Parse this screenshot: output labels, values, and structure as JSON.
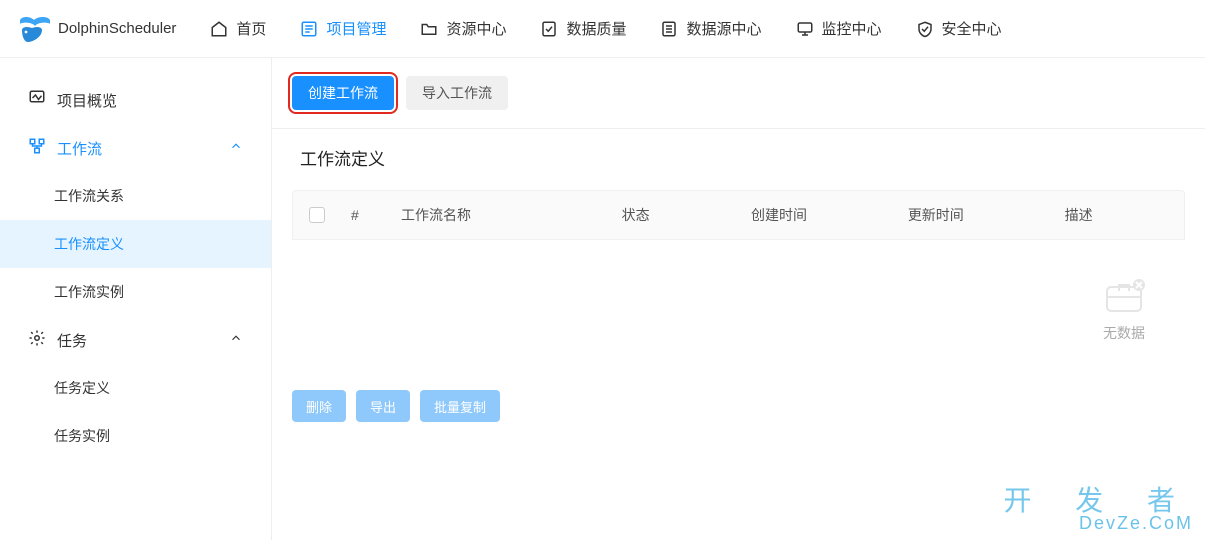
{
  "brand": {
    "name": "DolphinScheduler"
  },
  "topnav": [
    {
      "key": "home",
      "label": "首页"
    },
    {
      "key": "project",
      "label": "项目管理"
    },
    {
      "key": "resource",
      "label": "资源中心"
    },
    {
      "key": "dataquality",
      "label": "数据质量"
    },
    {
      "key": "datasource",
      "label": "数据源中心"
    },
    {
      "key": "monitor",
      "label": "监控中心"
    },
    {
      "key": "security",
      "label": "安全中心"
    }
  ],
  "sidebar": {
    "overview": "项目概览",
    "workflow": {
      "label": "工作流",
      "items": [
        "工作流关系",
        "工作流定义",
        "工作流实例"
      ]
    },
    "task": {
      "label": "任务",
      "items": [
        "任务定义",
        "任务实例"
      ]
    }
  },
  "toolbar": {
    "create": "创建工作流",
    "import": "导入工作流"
  },
  "section_title": "工作流定义",
  "table": {
    "headers": {
      "idx": "#",
      "name": "工作流名称",
      "status": "状态",
      "ctime": "创建时间",
      "utime": "更新时间",
      "desc": "描述"
    },
    "empty_text": "无数据",
    "rows": []
  },
  "footer_actions": {
    "delete": "删除",
    "export": "导出",
    "batch_copy": "批量复制"
  },
  "watermark": {
    "line1": "开 发 者",
    "line2": "DevZe.CoM"
  }
}
